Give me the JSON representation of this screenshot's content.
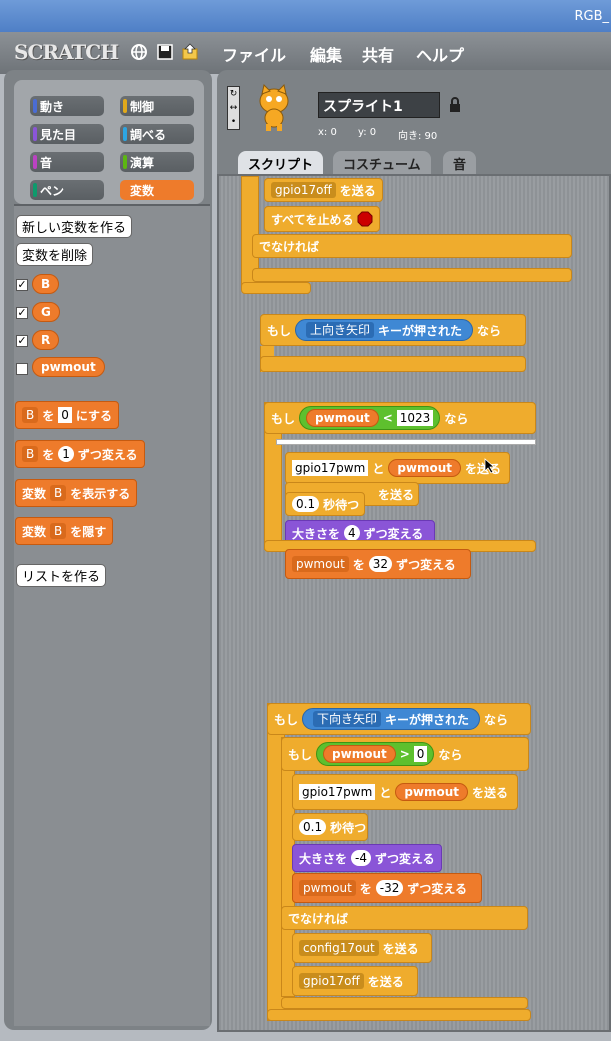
{
  "window": {
    "title": "RGB_"
  },
  "topbar": {
    "logo": "SCRATCH",
    "menus": [
      "ファイル",
      "編集",
      "共有",
      "ヘルプ"
    ]
  },
  "categories": [
    {
      "label": "動き",
      "color": "#4a6cd4"
    },
    {
      "label": "制御",
      "color": "#e1a91a"
    },
    {
      "label": "見た目",
      "color": "#8a55d7"
    },
    {
      "label": "調べる",
      "color": "#2ca5e2"
    },
    {
      "label": "音",
      "color": "#bb42c3"
    },
    {
      "label": "演算",
      "color": "#5cb712"
    },
    {
      "label": "ペン",
      "color": "#0e9a6c"
    },
    {
      "label": "変数",
      "color": "#ee7b2b",
      "selected": true
    }
  ],
  "palette": {
    "make_var": "新しい変数を作る",
    "delete_var": "変数を削除",
    "variables": [
      {
        "name": "B",
        "checked": true
      },
      {
        "name": "G",
        "checked": true
      },
      {
        "name": "R",
        "checked": true
      },
      {
        "name": "pwmout",
        "checked": false
      }
    ],
    "set_block": {
      "var": "B",
      "mid": "を",
      "value": "0",
      "tail": "にする"
    },
    "change_block": {
      "var": "B",
      "mid": "を",
      "value": "1",
      "tail": "ずつ変える"
    },
    "show_block": {
      "head": "変数",
      "var": "B",
      "tail": "を表示する"
    },
    "hide_block": {
      "head": "変数",
      "var": "B",
      "tail": "を隠す"
    },
    "make_list": "リストを作る"
  },
  "sprite": {
    "name": "スプライト1",
    "x_label": "x: 0",
    "y_label": "y: 0",
    "dir_label": "向き: 90"
  },
  "tabs": [
    "スクリプト",
    "コスチューム",
    "音"
  ],
  "script": {
    "send": "を送る",
    "if": "もし",
    "else": "でなければ",
    "then": "なら",
    "stop_all": "すべてを止める",
    "key_pressed": "キーが押された",
    "and": "と",
    "wait_unit": "秒待つ",
    "size_prefix": "大きさを",
    "change_by": "ずつ変える",
    "by": "を",
    "top": {
      "msg": "gpio17off"
    },
    "up": {
      "key": "上向き矢印",
      "op_var": "pwmout",
      "op": "<",
      "op_val": "1023",
      "msg": "gpio17pwm",
      "msg_var": "pwmout",
      "wait": "0.1",
      "size_delta": "4",
      "change_var": "pwmout",
      "change_val": "32"
    },
    "down": {
      "key": "下向き矢印",
      "op_var": "pwmout",
      "op": ">",
      "op_val": "0",
      "msg": "gpio17pwm",
      "msg_var": "pwmout",
      "wait": "0.1",
      "size_delta": "-4",
      "change_var": "pwmout",
      "change_val": "-32",
      "else_msg1": "config17out",
      "else_msg2": "gpio17off"
    }
  }
}
